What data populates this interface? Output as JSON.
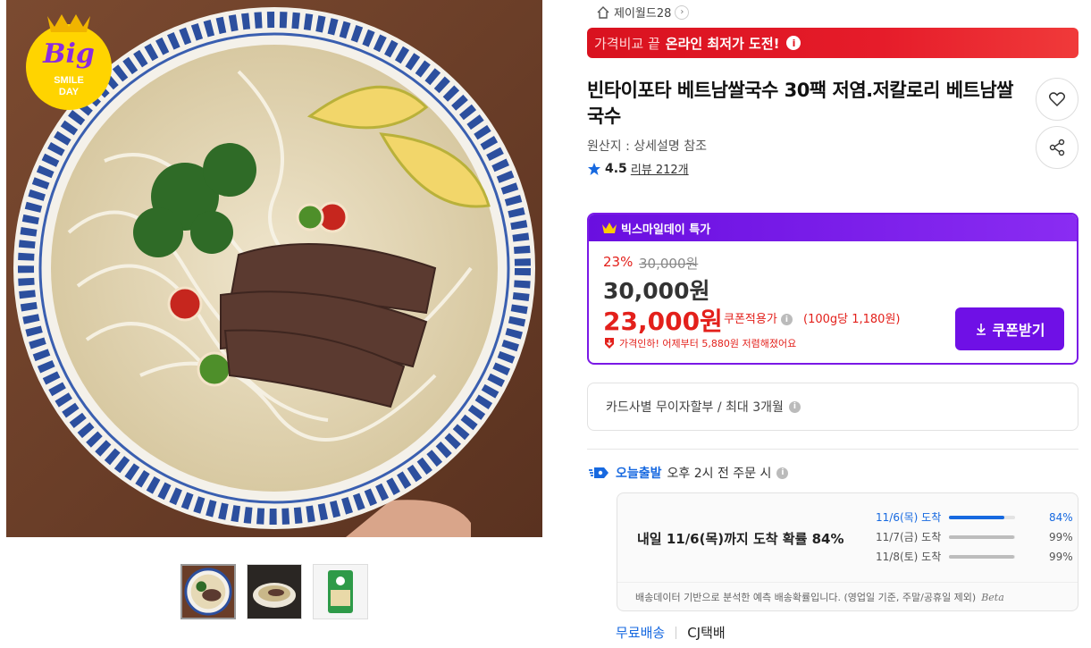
{
  "product_image": {
    "badge_big": "Big",
    "badge_sub1": "SMILE",
    "badge_sub2": "DAY"
  },
  "thumbnails": [
    "pho-bowl-thumb",
    "pho-dark-thumb",
    "package-thumb"
  ],
  "seller": {
    "name": "제이월드28"
  },
  "promo_banner": {
    "prefix": "가격비교 끝",
    "highlight": "온라인 최저가 도전!"
  },
  "product": {
    "title": "빈타이포타 베트남쌀국수 30팩 저염.저칼로리 베트남쌀국수",
    "origin": "원산지 : 상세설명 참조",
    "rating": "4.5",
    "reviews": "리뷰 212개"
  },
  "deal": {
    "label": "빅스마일데이 특가",
    "discount_rate": "23%",
    "original_price": "30,000원",
    "list_price": "30,000원",
    "coupon_price": "23,000원",
    "coupon_tag": "쿠폰적용가",
    "unit_price": "(100g당 1,180원)",
    "price_drop": "가격인하! 어제부터 5,880원 저렴해졌어요",
    "coupon_button": "쿠폰받기"
  },
  "installment": {
    "text": "카드사별 무이자할부 / 최대 3개월"
  },
  "delivery": {
    "brand": "오늘출발",
    "condition": "오후 2시 전 주문 시",
    "summary": "내일 11/6(목)까지 도착 확률 84%",
    "rows": [
      {
        "label": "11/6(목) 도착",
        "pct": "84%",
        "value": 0.84
      },
      {
        "label": "11/7(금) 도착",
        "pct": "99%",
        "value": 0.99
      },
      {
        "label": "11/8(토) 도착",
        "pct": "99%",
        "value": 0.99
      }
    ],
    "footnote": "배송데이터 기반으로 분석한 예측 배송확률입니다. (영업일 기준, 주말/공휴일 제외)",
    "beta": "Beta",
    "free_shipping": "무료배송",
    "carrier": "CJ택배"
  },
  "colors": {
    "accent_purple": "#6f10e6",
    "accent_red": "#e3201b",
    "accent_blue": "#1769e0"
  }
}
